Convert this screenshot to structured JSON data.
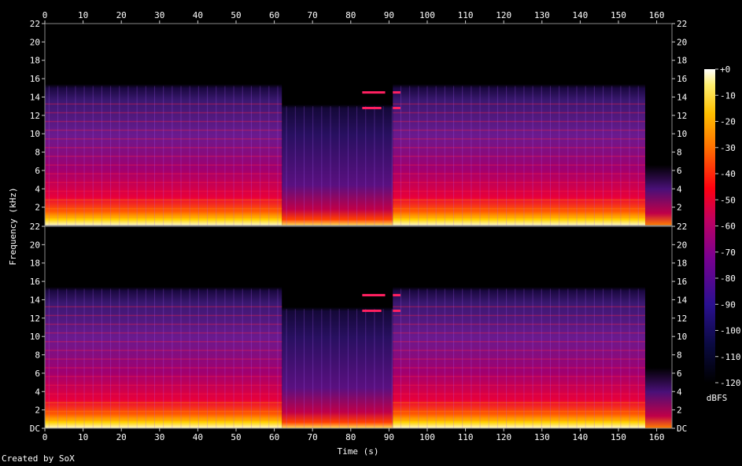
{
  "chart_data": {
    "type": "heatmap",
    "title": "",
    "caption": "Created by SoX",
    "xlabel": "Time (s)",
    "ylabel": "Frequency (kHz)",
    "colorbar_label": "dBFS",
    "x_ticks": [
      0,
      10,
      20,
      30,
      40,
      50,
      60,
      70,
      80,
      90,
      100,
      110,
      120,
      130,
      140,
      150,
      160
    ],
    "xlim": [
      0,
      164
    ],
    "y_ticks": [
      "DC",
      "2",
      "4",
      "6",
      "8",
      "10",
      "12",
      "14",
      "16",
      "18",
      "20",
      "22"
    ],
    "ylim": [
      0,
      22
    ],
    "colorbar_ticks": [
      "+0",
      "-10",
      "-20",
      "-30",
      "-40",
      "-50",
      "-60",
      "-70",
      "-80",
      "-90",
      "-100",
      "-110",
      "-120"
    ],
    "colorbar_range": [
      -120,
      0
    ],
    "channels": [
      {
        "name": "",
        "segments": [
          {
            "t": [
              0,
              62
            ],
            "cutoff_khz": 15.2,
            "level": "high"
          },
          {
            "t": [
              62,
              91
            ],
            "cutoff_khz": 13.0,
            "level": "low"
          },
          {
            "t": [
              91,
              157
            ],
            "cutoff_khz": 14.8,
            "level": "high"
          },
          {
            "t": [
              157,
              164
            ],
            "cutoff_khz": 4.0,
            "level": "fade"
          }
        ]
      },
      {
        "name": "",
        "segments": [
          {
            "t": [
              0,
              62
            ],
            "cutoff_khz": 15.2,
            "level": "high"
          },
          {
            "t": [
              62,
              91
            ],
            "cutoff_khz": 13.0,
            "level": "low"
          },
          {
            "t": [
              91,
              157
            ],
            "cutoff_khz": 14.8,
            "level": "high"
          },
          {
            "t": [
              157,
              164
            ],
            "cutoff_khz": 4.0,
            "level": "fade"
          }
        ]
      }
    ]
  }
}
